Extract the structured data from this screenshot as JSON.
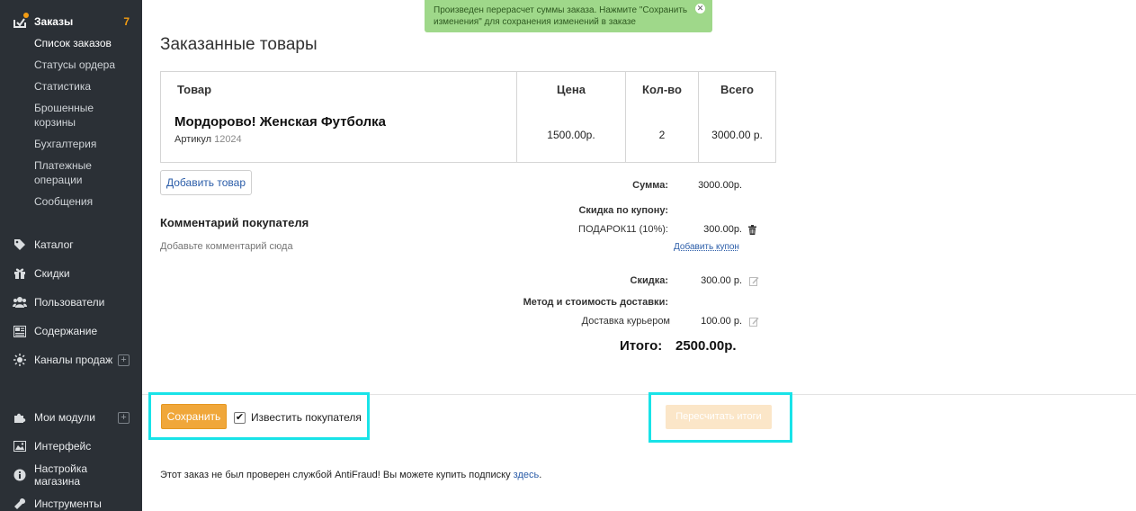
{
  "sidebar": {
    "orders": {
      "label": "Заказы",
      "count": "7"
    },
    "submenu": [
      "Список заказов",
      "Статусы ордера",
      "Статистика",
      "Брошенные корзины",
      "Бухгалтерия",
      "Платежные операции",
      "Сообщения"
    ],
    "menu": [
      {
        "label": "Каталог",
        "icon": "tag-icon"
      },
      {
        "label": "Скидки",
        "icon": "gift-icon"
      },
      {
        "label": "Пользователи",
        "icon": "users-icon"
      },
      {
        "label": "Содержание",
        "icon": "content-icon"
      },
      {
        "label": "Каналы продаж",
        "icon": "sun-icon"
      },
      {
        "label": "Мои модули",
        "icon": "puzzle-icon"
      },
      {
        "label": "Интерфейс",
        "icon": "image-icon"
      },
      {
        "label": "Настройка магазина",
        "icon": "info-icon"
      },
      {
        "label": "Инструменты",
        "icon": "wrench-icon"
      }
    ]
  },
  "notification": {
    "text": "Произведен перерасчет суммы заказа. Нажмите \"Сохранить изменения\" для сохранения изменений в заказе"
  },
  "page_title": "Заказанные товары",
  "table": {
    "headers": {
      "product": "Товар",
      "price": "Цена",
      "qty": "Кол-во",
      "total": "Всего"
    },
    "rows": [
      {
        "name": "Мордорово! Женская Футболка",
        "article_label": "Артикул",
        "article": "12024",
        "price": "1500.00р.",
        "qty": "2",
        "total": "3000.00 р."
      }
    ]
  },
  "add_product_label": "Добавить товар",
  "comment": {
    "title": "Комментарий покупателя",
    "placeholder": "Добавьте комментарий сюда"
  },
  "summary": {
    "sum_label": "Сумма:",
    "sum_value": "3000.00р.",
    "coupon_label": "Скидка по купону:",
    "coupon_name": "ПОДАРОК11 (10%):",
    "coupon_value": "300.00р.",
    "add_coupon": "Добавить купон",
    "discount_label": "Скидка:",
    "discount_value": "300.00 р.",
    "delivery_label": "Метод и стоимость доставки:",
    "delivery_name": "Доставка курьером",
    "delivery_value": "100.00 р.",
    "total_label": "Итого:",
    "total_value": "2500.00р."
  },
  "actions": {
    "save_label": "Сохранить",
    "notify_label": "Известить покупателя",
    "notify_checked": true,
    "recalc_label": "Пересчитать итоги"
  },
  "antifraud": {
    "text": "Этот заказ не был проверен службой AntiFraud! Вы можете купить подписку ",
    "link": "здесь",
    "end": "."
  },
  "colors": {
    "sidebar_bg": "#2b3036",
    "accent_orange": "#f0a73a",
    "highlight": "#19e3e8",
    "notice_bg": "#9fd88a",
    "link": "#2a5ca8"
  }
}
